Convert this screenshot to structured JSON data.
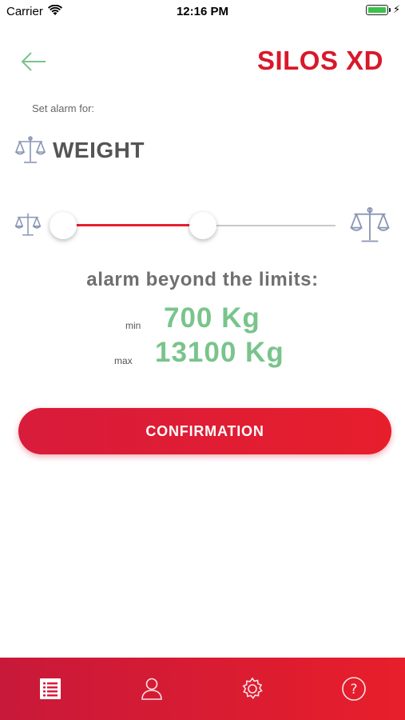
{
  "status_bar": {
    "carrier": "Carrier",
    "time": "12:16 PM"
  },
  "header": {
    "title": "SILOS XD",
    "back_icon": "arrow-left-icon",
    "brand_color": "#d9182a"
  },
  "alarm": {
    "set_label": "Set alarm for:",
    "type": "WEIGHT",
    "type_icon": "scale-icon"
  },
  "slider": {
    "range_start_fraction": 0,
    "range_end_fraction": 0.5
  },
  "limits": {
    "heading": "alarm beyond the limits:",
    "min_label": "min",
    "min_value": "700 Kg",
    "max_label": "max",
    "max_value": "13100 Kg",
    "value_color": "#79c48c"
  },
  "actions": {
    "confirm_label": "CONFIRMATION"
  },
  "tab_bar": {
    "items": [
      {
        "icon": "list-icon",
        "active": true
      },
      {
        "icon": "user-icon",
        "active": false
      },
      {
        "icon": "gear-icon",
        "active": false
      },
      {
        "icon": "help-icon",
        "active": false
      }
    ]
  }
}
